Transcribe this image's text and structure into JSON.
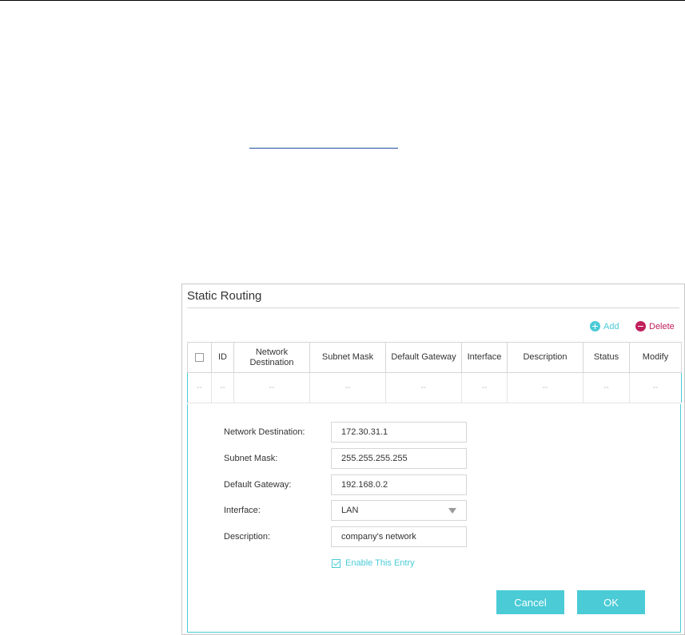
{
  "panel": {
    "title": "Static Routing"
  },
  "toolbar": {
    "add_label": "Add",
    "delete_label": "Delete",
    "add_icon": "plus-circle-icon",
    "delete_icon": "minus-circle-icon"
  },
  "table": {
    "columns": [
      "ID",
      "Network Destination",
      "Subnet Mask",
      "Default Gateway",
      "Interface",
      "Description",
      "Status",
      "Modify"
    ],
    "empty_cell": "--"
  },
  "form": {
    "network_destination": {
      "label": "Network Destination:",
      "value": "172.30.31.1"
    },
    "subnet_mask": {
      "label": "Subnet Mask:",
      "value": "255.255.255.255"
    },
    "default_gateway": {
      "label": "Default Gateway:",
      "value": "192.168.0.2"
    },
    "interface": {
      "label": "Interface:",
      "value": "LAN"
    },
    "description": {
      "label": "Description:",
      "value": "company's network"
    },
    "enable_entry": {
      "label": "Enable This Entry",
      "checked": true
    }
  },
  "buttons": {
    "cancel": "Cancel",
    "ok": "OK"
  },
  "colors": {
    "accent": "#4acbd6",
    "delete": "#c0205c"
  }
}
